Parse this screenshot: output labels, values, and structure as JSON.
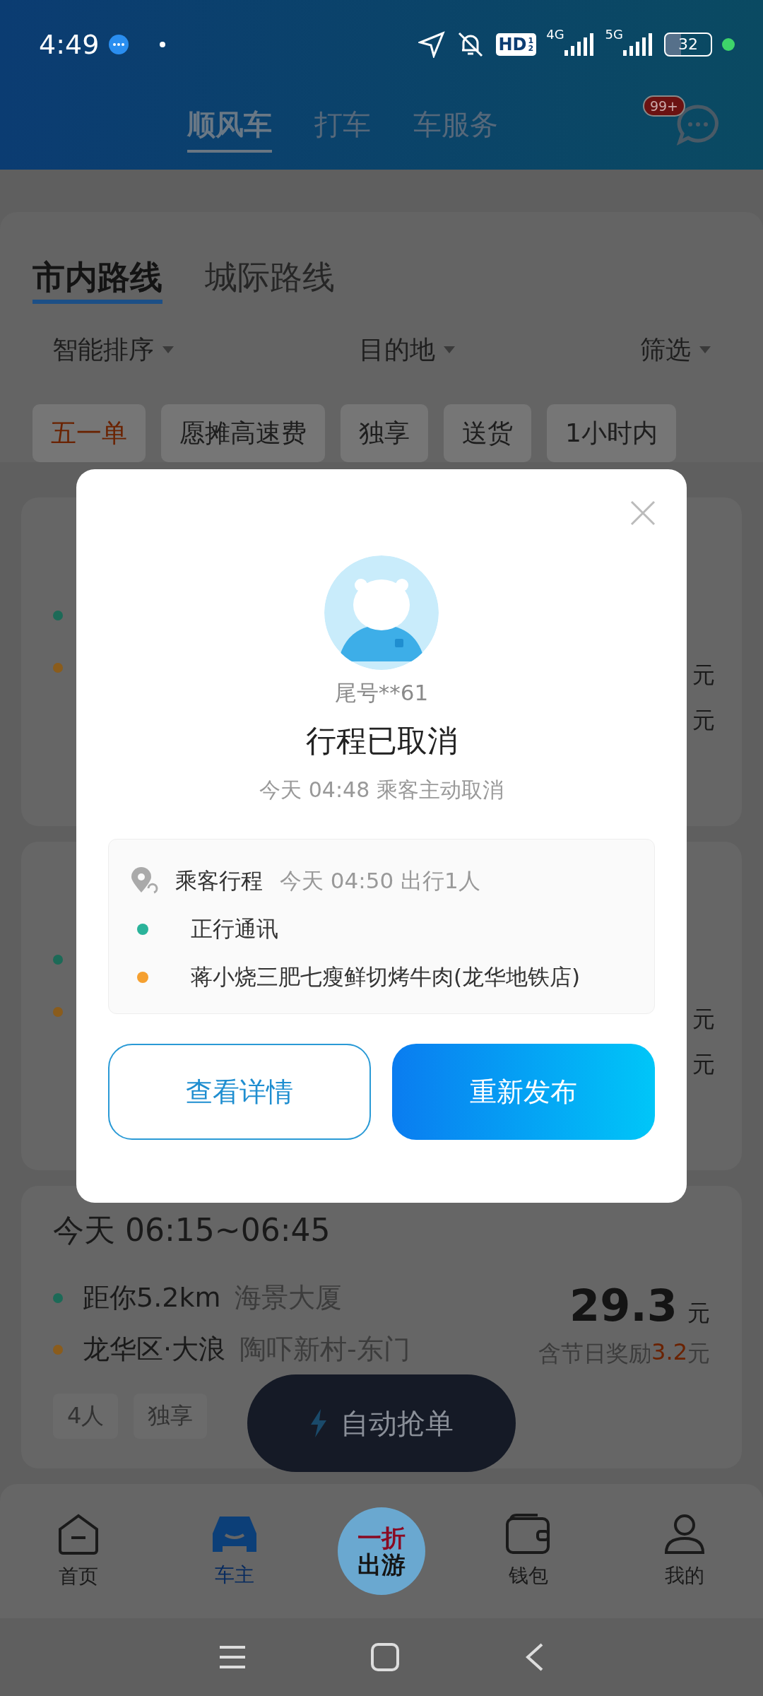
{
  "status_bar": {
    "time": "4:49",
    "hd": "HD",
    "hd_fraction": [
      "1",
      "2"
    ],
    "networks": [
      "4G",
      "5G"
    ],
    "battery": "32"
  },
  "header": {
    "tabs": [
      {
        "label": "顺风车",
        "selected": true
      },
      {
        "label": "打车",
        "selected": false
      },
      {
        "label": "车服务",
        "selected": false
      }
    ],
    "message_badge": "99+"
  },
  "route_tabs": [
    {
      "label": "市内路线",
      "selected": true
    },
    {
      "label": "城际路线",
      "selected": false
    }
  ],
  "sort_options": [
    "智能排序",
    "目的地",
    "筛选"
  ],
  "filter_chips": [
    {
      "label": "五一单",
      "selected": true
    },
    {
      "label": "愿摊高速费",
      "selected": false
    },
    {
      "label": "独享",
      "selected": false
    },
    {
      "label": "送货",
      "selected": false
    },
    {
      "label": "1小时内",
      "selected": false
    }
  ],
  "partial_cards": [
    {
      "dots": [
        {
          "color": "#1c6a57"
        },
        {
          "color": "#8a5c1c"
        }
      ],
      "right_texts": [
        "元",
        "元"
      ]
    },
    {
      "dots": [
        {
          "color": "#1c6a57"
        },
        {
          "color": "#8a5c1c"
        }
      ],
      "right_texts": [
        "元",
        "元"
      ]
    }
  ],
  "card": {
    "time": "今天 06:15~06:45",
    "stops": [
      {
        "color": "#1c6a57",
        "label": "距你5.2km",
        "place": "海景大厦"
      },
      {
        "color": "#8a5c1c",
        "label": "龙华区·大浪",
        "place": "陶吓新村-东门"
      }
    ],
    "price": "29.3",
    "unit": "元",
    "bonus_prefix": "含节日奖励",
    "bonus_amount": "3.2",
    "bonus_unit": "元",
    "tags": [
      "4人",
      "独享"
    ]
  },
  "auto_grab_button": "自动抢单",
  "bottom_nav": [
    {
      "label": "首页",
      "selected": false
    },
    {
      "label": "车主",
      "selected": true
    },
    {
      "kind": "promo",
      "lines": [
        "一折",
        "出游"
      ]
    },
    {
      "label": "钱包",
      "selected": false
    },
    {
      "label": "我的",
      "selected": false
    }
  ],
  "modal": {
    "user": "尾号**61",
    "title": "行程已取消",
    "subtitle": "今天 04:48 乘客主动取消",
    "trip": {
      "label": "乘客行程",
      "info": "今天 04:50 出行1人",
      "stops": [
        {
          "color": "#2ab39a",
          "name": "正行通讯"
        },
        {
          "color": "#f5a030",
          "name": "蒋小烧三肥七瘦鲜切烤牛肉(龙华地铁店)"
        }
      ]
    },
    "buttons": [
      {
        "label": "查看详情",
        "kind": "outline"
      },
      {
        "label": "重新发布",
        "kind": "primary"
      }
    ]
  }
}
